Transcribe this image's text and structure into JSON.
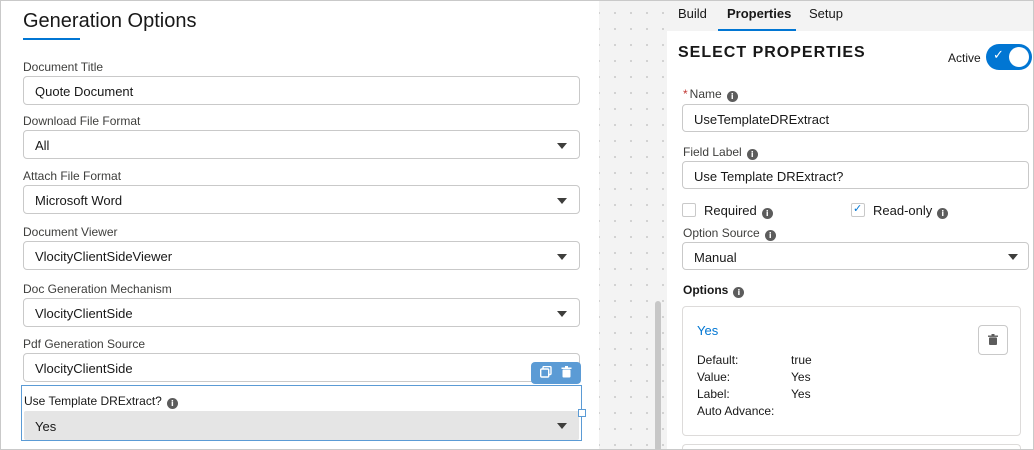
{
  "generation": {
    "title": "Generation Options",
    "fields": [
      {
        "label": "Document Title",
        "value": "Quote Document",
        "type": "text"
      },
      {
        "label": "Download File Format",
        "value": "All",
        "type": "select"
      },
      {
        "label": "Attach File Format",
        "value": "Microsoft Word",
        "type": "select"
      },
      {
        "label": "Document Viewer",
        "value": "VlocityClientSideViewer",
        "type": "select"
      },
      {
        "label": "Doc Generation Mechanism",
        "value": "VlocityClientSide",
        "type": "select"
      },
      {
        "label": "Pdf Generation Source",
        "value": "VlocityClientSide",
        "type": "text"
      }
    ],
    "selected_field": {
      "label": "Use Template DRExtract?",
      "value": "Yes"
    }
  },
  "tabs": [
    {
      "label": "Build"
    },
    {
      "label": "Properties"
    },
    {
      "label": "Setup"
    }
  ],
  "active_tab": "Properties",
  "properties": {
    "title": "SELECT PROPERTIES",
    "active_label": "Active",
    "active_on": true,
    "name_label": "Name",
    "name_value": "UseTemplateDRExtract",
    "field_label_label": "Field Label",
    "field_label_value": "Use Template DRExtract?",
    "required_label": "Required",
    "required_checked": false,
    "readonly_label": "Read-only",
    "readonly_checked": true,
    "option_source_label": "Option Source",
    "option_source_value": "Manual",
    "options_label": "Options",
    "option": {
      "name": "Yes",
      "default_key": "Default:",
      "default_value": "true",
      "value_key": "Value:",
      "value_value": "Yes",
      "label_key": "Label:",
      "label_value": "Yes",
      "auto_advance_key": "Auto Advance:"
    }
  },
  "colors": {
    "accent": "#0176d3",
    "selection": "#5b9bd5"
  }
}
